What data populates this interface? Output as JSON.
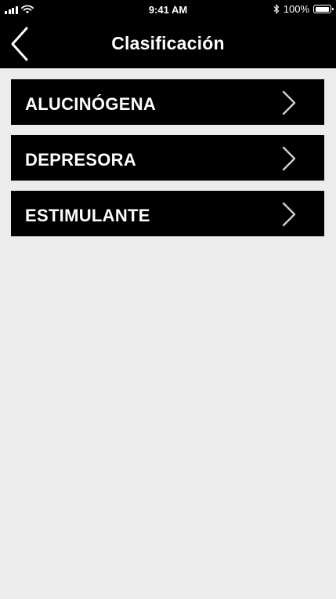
{
  "status_bar": {
    "time": "9:41 AM",
    "battery_text": "100%",
    "battery_level": 1.0,
    "icons": [
      "signal-icon",
      "wifi-icon",
      "bluetooth-icon",
      "battery-icon"
    ]
  },
  "nav": {
    "title": "Clasificación",
    "back_icon": "back-chevron-icon"
  },
  "classifications": [
    {
      "label": "ALUCINÓGENA",
      "icon": "chevron-right-icon"
    },
    {
      "label": "DEPRESORA",
      "icon": "chevron-right-icon"
    },
    {
      "label": "ESTIMULANTE",
      "icon": "chevron-right-icon"
    }
  ],
  "colors": {
    "bar_background": "#000000",
    "item_background": "#000000",
    "page_background": "#ececec",
    "text": "#ffffff",
    "chevron": "#cfcfcf"
  }
}
